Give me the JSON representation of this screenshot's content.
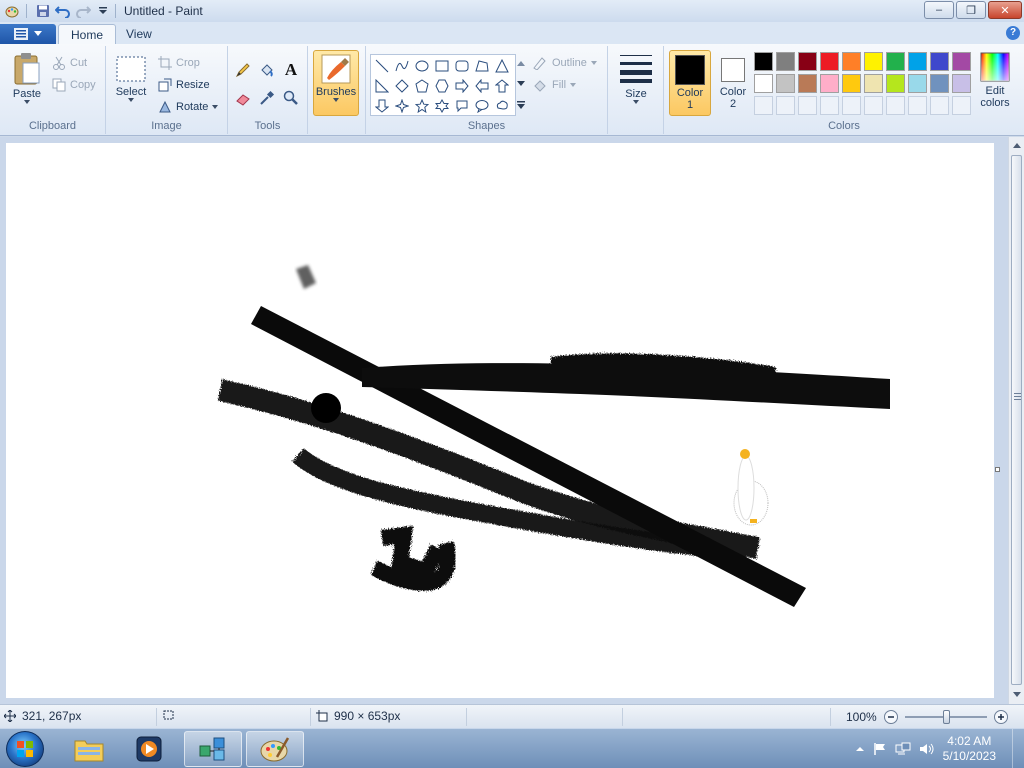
{
  "window": {
    "title": "Untitled - Paint",
    "minimize_label": "–",
    "restore_label": "❐",
    "close_label": "✕"
  },
  "tabs": [
    {
      "label": "Home",
      "active": true
    },
    {
      "label": "View",
      "active": false
    }
  ],
  "help_label": "?",
  "clipboard": {
    "group_label": "Clipboard",
    "paste_label": "Paste",
    "cut_label": "Cut",
    "copy_label": "Copy"
  },
  "image": {
    "group_label": "Image",
    "select_label": "Select",
    "crop_label": "Crop",
    "resize_label": "Resize",
    "rotate_label": "Rotate"
  },
  "tools": {
    "group_label": "Tools",
    "text_glyph": "A"
  },
  "brushes": {
    "label": "Brushes"
  },
  "shapes": {
    "group_label": "Shapes",
    "outline_label": "Outline",
    "fill_label": "Fill"
  },
  "size": {
    "label": "Size"
  },
  "colors": {
    "group_label": "Colors",
    "color1_label": "Color",
    "color1_num": "1",
    "color2_label": "Color",
    "color2_num": "2",
    "edit_label": "Edit",
    "edit_label2": "colors",
    "color1_value": "#000000",
    "color2_value": "#ffffff",
    "palette_row1": [
      "#000000",
      "#7f7f7f",
      "#880015",
      "#ed1c24",
      "#ff7f27",
      "#fff200",
      "#22b14c",
      "#00a2e8",
      "#3f48cc",
      "#a349a4"
    ],
    "palette_row2": [
      "#ffffff",
      "#c3c3c3",
      "#b97a57",
      "#ffaec9",
      "#ffc90e",
      "#efe4b0",
      "#b5e61d",
      "#99d9ea",
      "#7092be",
      "#c8bfe7"
    ]
  },
  "status": {
    "cursor_pos": "321, 267px",
    "canvas_size": "990 × 653px",
    "zoom": "100%"
  },
  "taskbar": {
    "time": "4:02 AM",
    "date": "5/10/2023"
  }
}
